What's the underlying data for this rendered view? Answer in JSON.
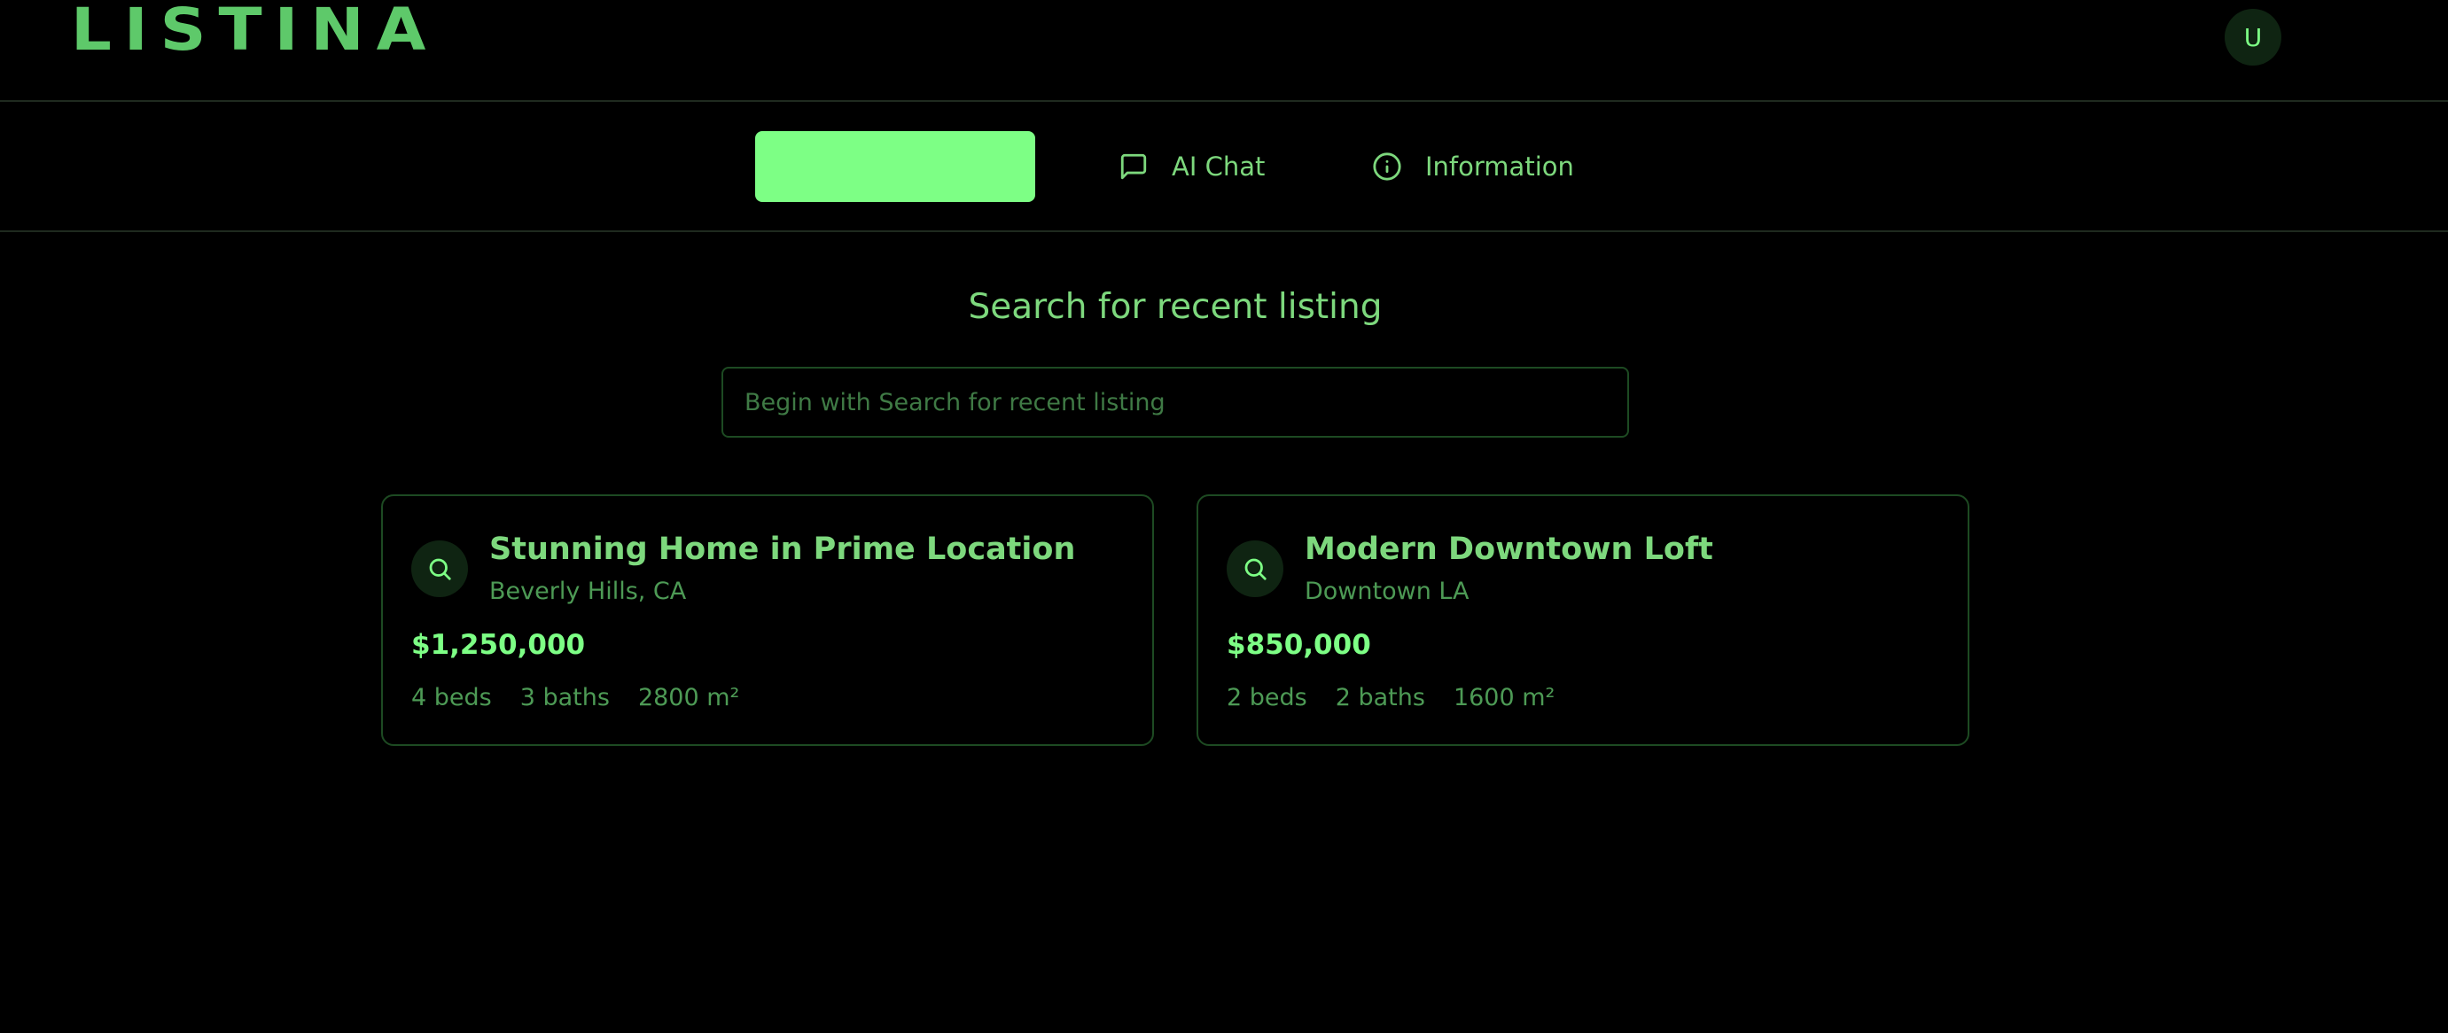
{
  "app": {
    "logo_text": "LISTINA",
    "user_initial": "U"
  },
  "nav": {
    "active_label": "",
    "items": [
      {
        "label": "AI Chat",
        "icon": "chat-bubble-icon"
      },
      {
        "label": "Information",
        "icon": "info-circle-icon"
      }
    ]
  },
  "search": {
    "heading": "Search for recent listing",
    "placeholder": "Begin with Search for recent listing",
    "value": ""
  },
  "listings": [
    {
      "title": "Stunning Home in Prime Location",
      "location": "Beverly Hills, CA",
      "price": "$1,250,000",
      "beds": "4 beds",
      "baths": "3 baths",
      "area": "2800 m²",
      "icon": "search-icon"
    },
    {
      "title": "Modern Downtown Loft",
      "location": "Downtown LA",
      "price": "$850,000",
      "beds": "2 beds",
      "baths": "2 baths",
      "area": "1600 m²",
      "icon": "search-icon"
    }
  ],
  "colors": {
    "background": "#000000",
    "accent": "#7dff85",
    "text": "#7dd87d",
    "muted_text": "#4d9a55",
    "border": "#1d4a22"
  }
}
